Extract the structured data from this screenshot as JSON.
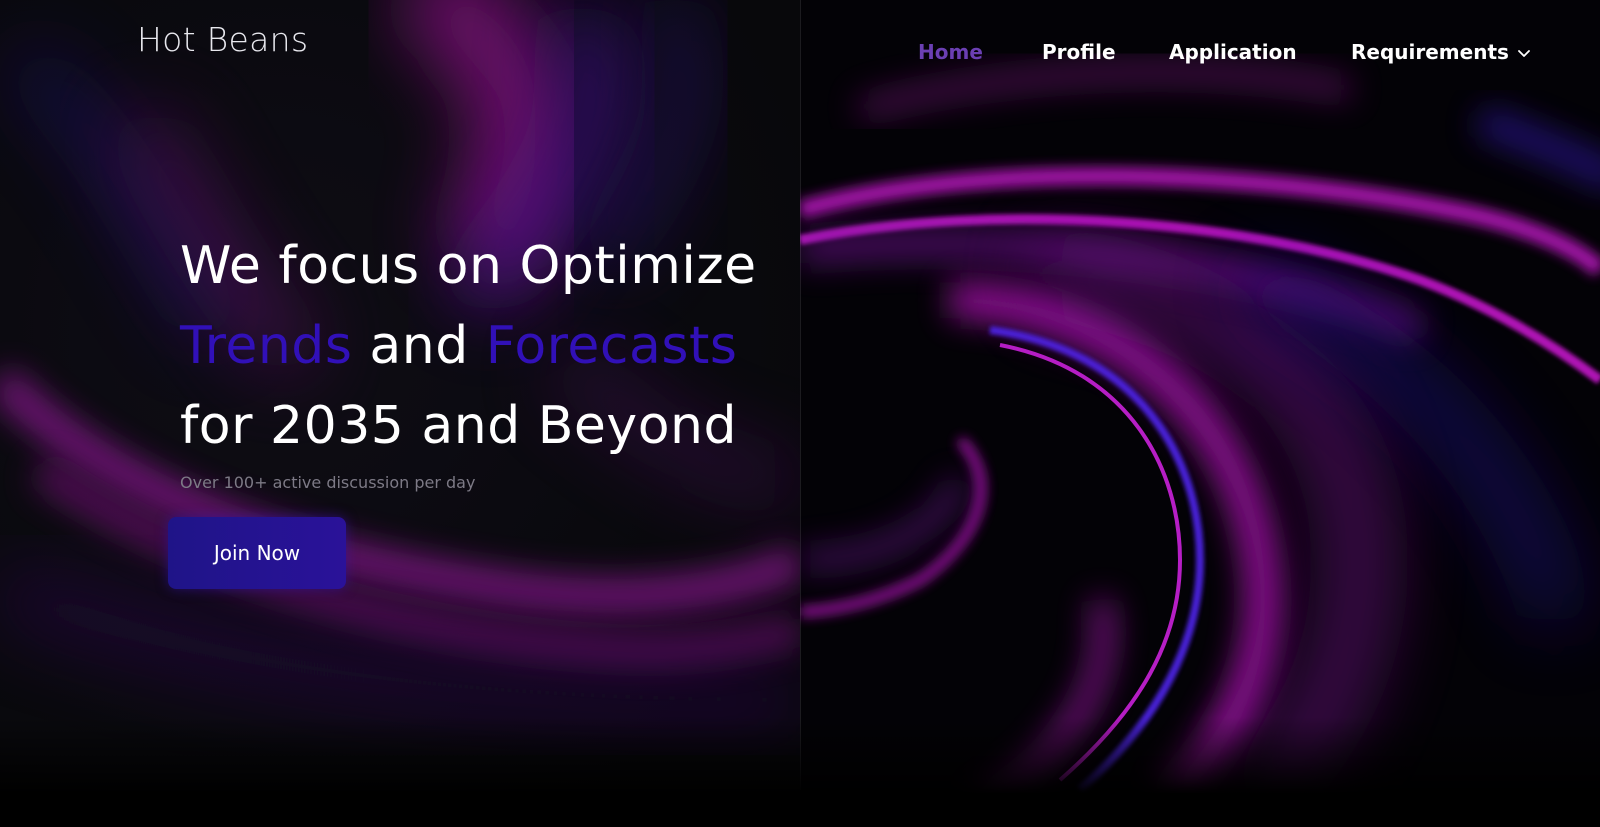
{
  "brand": {
    "logo_text": "Hot Beans"
  },
  "nav": {
    "items": [
      {
        "label": "Home",
        "active": true
      },
      {
        "label": "Profile",
        "active": false
      },
      {
        "label": "Application",
        "active": false
      },
      {
        "label": "Requirements",
        "active": false,
        "has_dropdown": true
      }
    ]
  },
  "hero": {
    "line1": "We focus on Optimize",
    "line2_accent1": "Trends",
    "line2_mid": " and ",
    "line2_accent2": "Forecasts",
    "line3": "for 2035 and Beyond",
    "subtext": "Over 100+ active discussion per day",
    "cta_label": "Join Now"
  },
  "colors": {
    "accent": "#3110b8",
    "nav_active": "#6b3fb3",
    "button": "#24138f",
    "swirl_magenta": "#b012b8",
    "swirl_blue": "#3a1bd0"
  },
  "icons": {
    "dropdown": "chevron-down-icon"
  }
}
